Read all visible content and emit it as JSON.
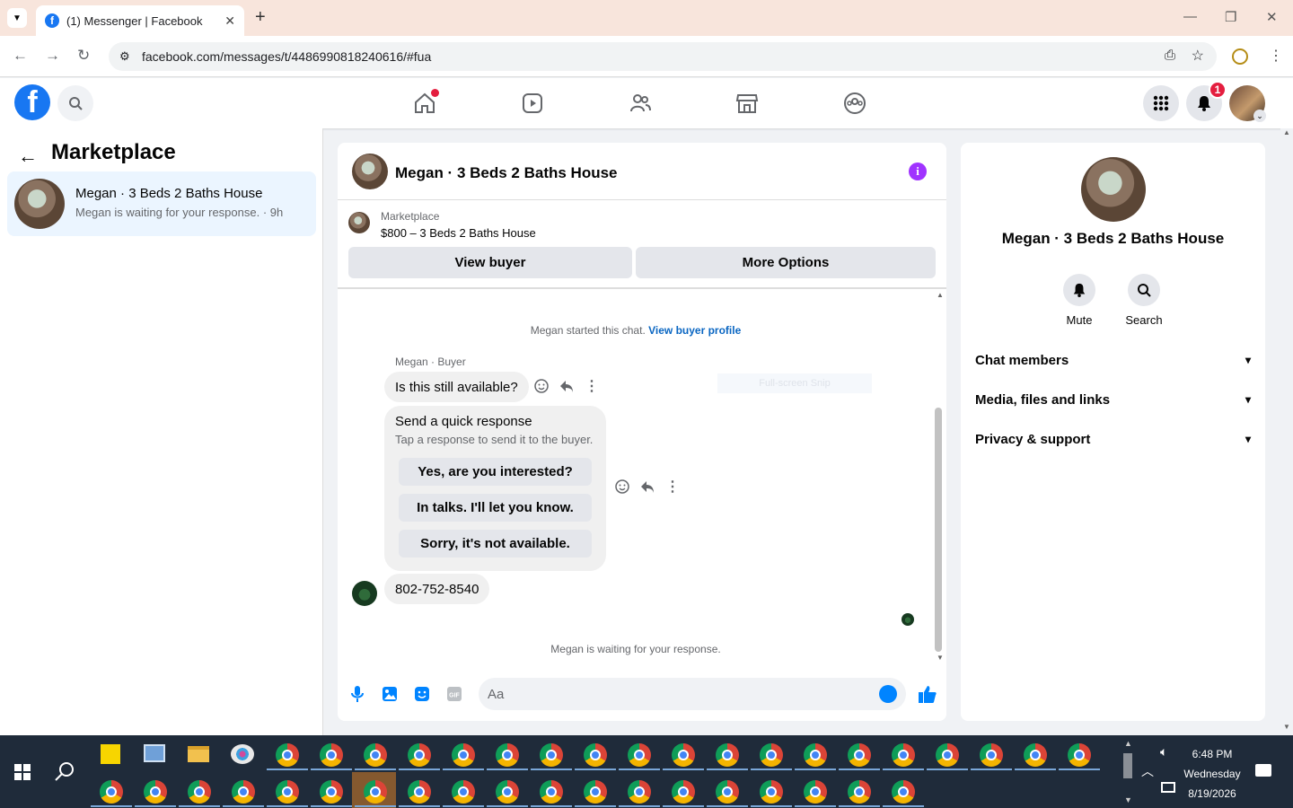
{
  "browser": {
    "tab_title": "(1) Messenger | Facebook",
    "url": "facebook.com/messages/t/4486990818240616/#fua"
  },
  "header": {
    "notification_count": "1"
  },
  "left": {
    "title": "Marketplace",
    "thread_name": "Megan · 3 Beds 2 Baths House",
    "thread_sub": "Megan is waiting for your response. · 9h"
  },
  "chat": {
    "title": "Megan · 3 Beds 2 Baths House",
    "mp_label": "Marketplace",
    "mp_price": "$800 – 3 Beds 2 Baths House",
    "view_buyer": "View buyer",
    "more_options": "More Options",
    "started_text": "Megan started this chat.",
    "buyer_profile_link": "View buyer profile",
    "sender_name": "Megan · Buyer",
    "message1": "Is this still available?",
    "quick_title": "Send a quick response",
    "quick_sub": "Tap a response to send it to the buyer.",
    "quick_replies": [
      "Yes, are you interested?",
      "In talks. I'll let you know.",
      "Sorry, it's not available."
    ],
    "message2": "802-752-8540",
    "waiting_text": "Megan is waiting for your response.",
    "input_placeholder": "Aa",
    "snip_text": "Full-screen Snip"
  },
  "right": {
    "title": "Megan · 3 Beds 2 Baths House",
    "mute_label": "Mute",
    "search_label": "Search",
    "sections": [
      "Chat members",
      "Media, files and links",
      "Privacy & support"
    ]
  },
  "taskbar": {
    "time": "6:48 PM",
    "day": "Wednesday",
    "date": "8/19/2026"
  },
  "colors": {
    "accent": "#0084ff",
    "fb_blue": "#1877f2",
    "info_purple": "#a033ff",
    "badge_red": "#e41e3f"
  }
}
